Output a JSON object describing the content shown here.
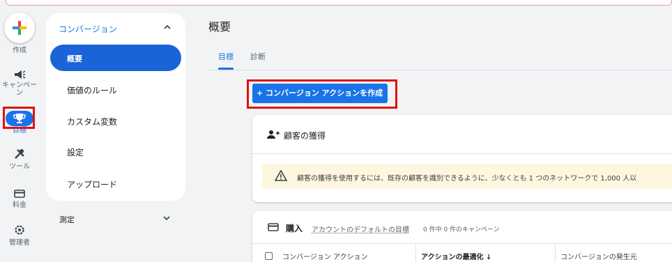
{
  "rail": {
    "create": "作成",
    "campaigns": "キャンペーン",
    "goals": "目標",
    "tools": "ツール",
    "billing": "料金",
    "admin": "管理者"
  },
  "subnav": {
    "header": "コンバージョン",
    "items": [
      "概要",
      "価値のルール",
      "カスタム変数",
      "設定",
      "アップロード"
    ],
    "measure": "測定"
  },
  "main": {
    "title": "概要",
    "tabs": [
      "目標",
      "診断"
    ],
    "create_button": "+ コンバージョン アクションを作成",
    "customer_card": {
      "title": "顧客の獲得",
      "warning": "顧客の獲得を使用するには、既存の顧客を識別できるように、少なくとも 1 つのネットワークで 1,000 人以"
    },
    "purchase_card": {
      "title": "購入",
      "link": "アカウントのデフォルトの目標",
      "count": "0 件中 0 件のキャンペーン",
      "columns": [
        "コンバージョン アクション",
        "アクションの最適化 ↓",
        "コンバージョンの発生元"
      ]
    }
  },
  "colors": {
    "accent": "#1a73e8",
    "highlight": "#e01010",
    "warning_bg": "#fef7e0"
  }
}
